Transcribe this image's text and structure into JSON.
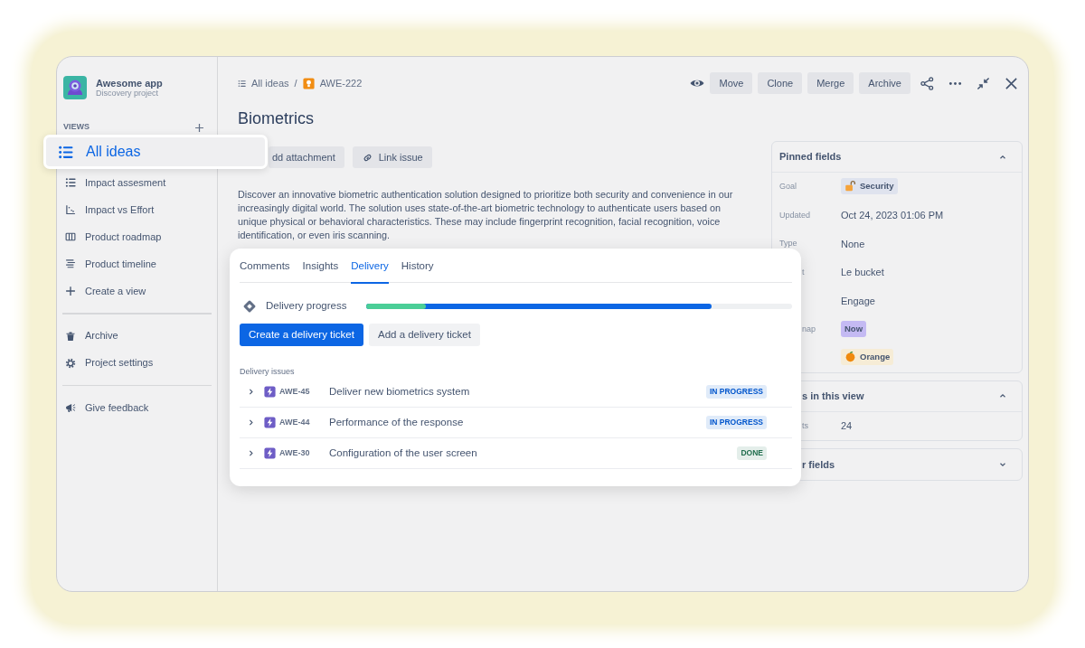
{
  "sidebar": {
    "app_name": "Awesome app",
    "project": "Discovery project",
    "views_heading": "VIEWS",
    "groups": [
      {
        "items": [
          {
            "label": "All ideas",
            "selected": true
          },
          {
            "label": "Impact assesment",
            "selected": false
          },
          {
            "label": "Impact vs Effort",
            "selected": false
          },
          {
            "label": "Product roadmap",
            "selected": false
          },
          {
            "label": "Product timeline",
            "selected": false
          },
          {
            "label": "Create a view",
            "selected": false
          }
        ]
      },
      {
        "items": [
          {
            "label": "Archive",
            "selected": false
          },
          {
            "label": "Project settings",
            "selected": false
          }
        ]
      },
      {
        "items": [
          {
            "label": "Give feedback",
            "selected": false
          }
        ]
      }
    ]
  },
  "breadcrumb": {
    "items": [
      "All ideas",
      "AWE-222"
    ],
    "separator": "/"
  },
  "actions": [
    "Move",
    "Clone",
    "Merge",
    "Archive"
  ],
  "idea": {
    "title": "Biometrics",
    "buttons": [
      "dd attachment",
      "Link issue"
    ],
    "description": "Discover an innovative biometric authentication solution designed to prioritize both security and convenience in our increasingly digital world. The solution uses state-of-the-art biometric technology to authenticate users based on unique physical or behavioral characteristics. These may include fingerprint recognition, facial recognition, voice identification, or even iris scanning."
  },
  "delivery_card": {
    "tabs": [
      {
        "label": "Comments",
        "selected": false
      },
      {
        "label": "Insights",
        "selected": false
      },
      {
        "label": "Delivery",
        "selected": true
      },
      {
        "label": "History",
        "selected": false
      }
    ],
    "progress": {
      "label": "Delivery progress",
      "segments": [
        {
          "color": "#4bce97",
          "level": 0.14
        },
        {
          "color": "#0c66e4",
          "level": 0.81
        }
      ]
    },
    "buttons": [
      {
        "label": "Create a delivery ticket",
        "kind": "primary"
      },
      {
        "label": "Add a delivery ticket",
        "kind": "default"
      }
    ],
    "issues_heading": "Delivery issues",
    "issues": [
      {
        "key": "AWE-45",
        "summary": "Deliver new biometrics system",
        "status": "IN PROGRESS",
        "color": "#0055cc",
        "expanded": false
      },
      {
        "key": "AWE-44",
        "summary": "Performance of the response",
        "status": "IN PROGRESS",
        "color": "#0055cc",
        "expanded": false
      },
      {
        "key": "AWE-30",
        "summary": "Configuration of the user screen",
        "status": "DONE",
        "color": "#216e4e",
        "expanded": false
      }
    ]
  },
  "panels": [
    {
      "title": "Pinned fields",
      "expanded": true,
      "rows": [
        {
          "label": "Goal",
          "value": "Security",
          "kind": "icon_tag",
          "color": "#dfe3ee"
        },
        {
          "label": "Updated",
          "value": "Oct 24, 2023 01:06 PM",
          "kind": "text"
        },
        {
          "label": "Type",
          "value": "None",
          "kind": "text"
        },
        {
          "label": "t",
          "value": "Le bucket",
          "kind": "text"
        },
        {
          "value": "Engage",
          "kind": "text"
        },
        {
          "label": "nap",
          "value": "Now",
          "kind": "tag",
          "color": "#c4baf3"
        },
        {
          "value": "Orange",
          "kind": "icon_tag",
          "color": "#f6ecd6"
        }
      ]
    },
    {
      "title": "s in this view",
      "expanded": true,
      "rows": [
        {
          "label": "ts",
          "value": "24",
          "kind": "text"
        }
      ]
    },
    {
      "title": "r fields",
      "expanded": false
    }
  ]
}
